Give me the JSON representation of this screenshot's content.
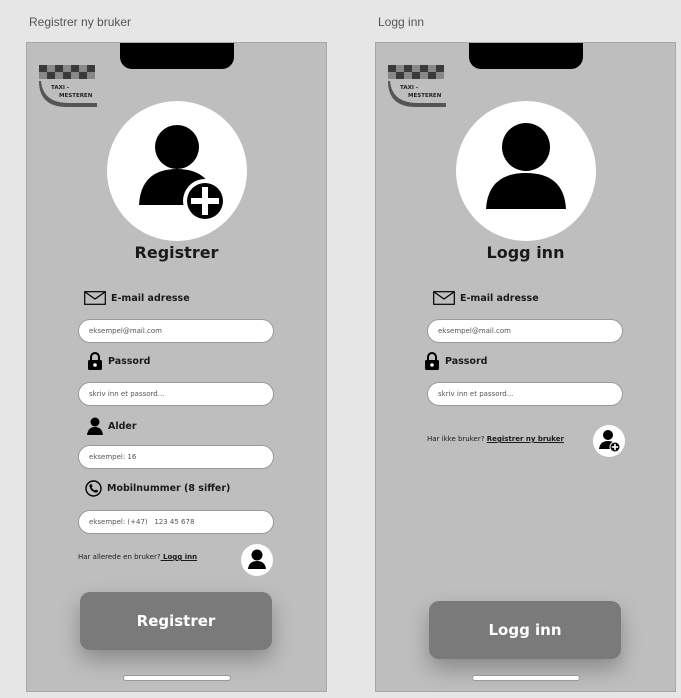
{
  "register": {
    "frame_title": "Registrer ny bruker",
    "heading": "Registrer",
    "email_label": "E-mail adresse",
    "email_placeholder": "eksempel@mail.com",
    "password_label": "Passord",
    "password_placeholder": "skriv inn et passord...",
    "age_label": "Alder",
    "age_placeholder": "eksempel: 16",
    "phone_label": "Mobilnummer (8 siffer)",
    "phone_placeholder": "eksempel: (+47)   123 45 678",
    "prompt_text": "Har allerede en bruker?",
    "prompt_link": " Logg inn",
    "submit_label": "Registrer"
  },
  "login": {
    "frame_title": "Logg inn",
    "heading": "Logg inn",
    "email_label": "E-mail adresse",
    "email_placeholder": "eksempel@mail.com",
    "password_label": "Passord",
    "password_placeholder": "skriv inn et passord...",
    "prompt_text": "Har ikke bruker? ",
    "prompt_link": "Registrer ny bruker",
    "submit_label": "Logg inn"
  },
  "logo": {
    "line1": "TAXI -",
    "line2": "MESTEREN"
  },
  "icons": {
    "avatar_add": "user-plus-icon",
    "avatar": "user-icon",
    "email": "envelope-icon",
    "password": "lock-icon",
    "age": "user-icon",
    "phone": "phone-icon"
  },
  "colors": {
    "background": "#e6e6e6",
    "phone": "#bebebe",
    "button": "#7a7a7a"
  }
}
